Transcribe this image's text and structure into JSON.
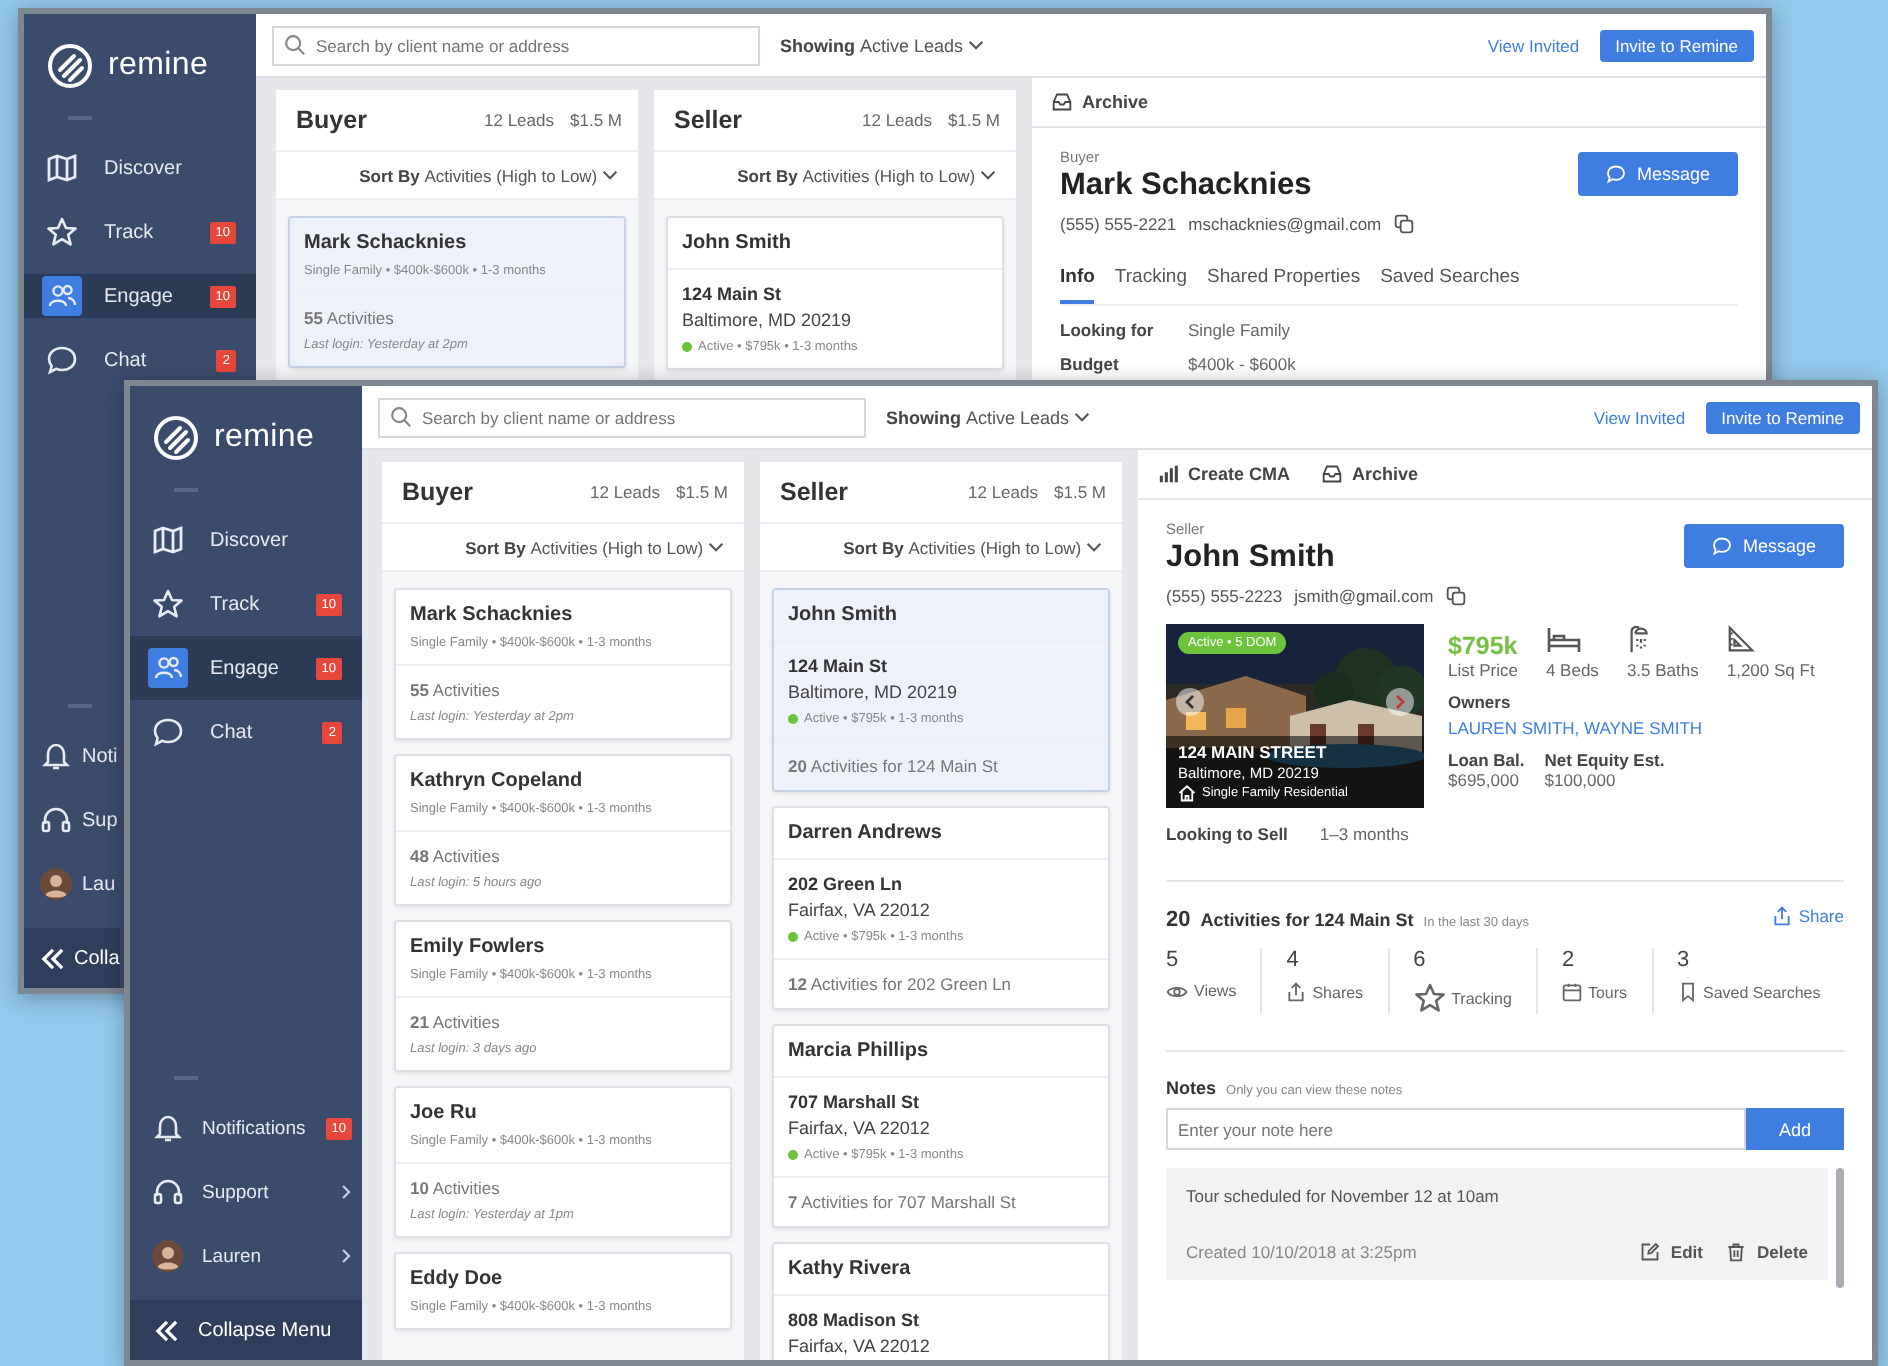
{
  "back_window": {
    "logo": "remine",
    "nav": [
      {
        "label": "Discover",
        "selected": false
      },
      {
        "label": "Track",
        "badge": "10",
        "selected": false
      },
      {
        "label": "Engage",
        "badge": "10",
        "selected": true
      },
      {
        "label": "Chat",
        "badge": "2",
        "selected": false
      }
    ],
    "bottom_nav": [
      {
        "label": "Noti"
      },
      {
        "label": "Sup"
      },
      {
        "label": "Lau"
      }
    ],
    "collapse": "Colla",
    "search": {
      "placeholder": "Search by client name or address"
    },
    "filter": {
      "prefix": "Showing",
      "value": "Active Leads"
    },
    "view_invited": "View Invited",
    "invite_button": "Invite to Remine",
    "columns": [
      {
        "title": "Buyer",
        "leads": "12 Leads",
        "total": "$1.5 M",
        "sort_label": "Sort By",
        "sort_value": "Activities (High to Low)",
        "cards": [
          {
            "kind": "buyer",
            "name": "Mark Schacknies",
            "details": "Single Family • $400k-$600k • 1-3 months",
            "activities": "**55** Activities",
            "last_login": "Last login: Yesterday at 2pm",
            "selected": true
          }
        ]
      },
      {
        "title": "Seller",
        "leads": "12 Leads",
        "total": "$1.5 M",
        "sort_label": "Sort By",
        "sort_value": "Activities (High to Low)",
        "cards": [
          {
            "kind": "seller",
            "name": "John Smith",
            "street": "124 Main St",
            "city": "Baltimore, MD 20219",
            "status": "Active • $795k • 1-3 months",
            "selected": false
          }
        ]
      }
    ],
    "detail": {
      "toolbar": [
        {
          "kind": "archive",
          "label": "Archive"
        }
      ],
      "role": "Buyer",
      "name": "Mark Schacknies",
      "message_button": "Message",
      "phone": "(555) 555-2221",
      "email": "mschacknies@gmail.com",
      "tabs": [
        {
          "label": "Info",
          "selected": true
        },
        {
          "label": "Tracking",
          "selected": false
        },
        {
          "label": "Shared Properties",
          "selected": false
        },
        {
          "label": "Saved Searches",
          "selected": false
        }
      ],
      "info": [
        {
          "label": "Looking for",
          "value": "Single Family"
        },
        {
          "label": "Budget",
          "value": "$400k - $600k"
        }
      ]
    }
  },
  "front_window": {
    "logo": "remine",
    "nav": [
      {
        "label": "Discover",
        "selected": false
      },
      {
        "label": "Track",
        "badge": "10",
        "selected": false
      },
      {
        "label": "Engage",
        "badge": "10",
        "selected": true
      },
      {
        "label": "Chat",
        "badge": "2",
        "selected": false
      }
    ],
    "bottom_nav": [
      {
        "label": "Notifications",
        "badge": "10",
        "chevron": false
      },
      {
        "label": "Support",
        "chevron": true
      },
      {
        "label": "Lauren",
        "chevron": true
      }
    ],
    "collapse": "Collapse Menu",
    "search": {
      "placeholder": "Search by client name or address"
    },
    "filter": {
      "prefix": "Showing",
      "value": "Active Leads"
    },
    "view_invited": "View Invited",
    "invite_button": "Invite to Remine",
    "columns": [
      {
        "title": "Buyer",
        "leads": "12 Leads",
        "total": "$1.5 M",
        "sort_label": "Sort By",
        "sort_value": "Activities (High to Low)",
        "cards": [
          {
            "kind": "buyer",
            "name": "Mark Schacknies",
            "details": "Single Family • $400k-$600k • 1-3 months",
            "activities": "**55** Activities",
            "last_login": "Last login: Yesterday at 2pm",
            "selected": false
          },
          {
            "kind": "buyer",
            "name": "Kathryn Copeland",
            "details": "Single Family • $400k-$600k • 1-3 months",
            "activities": "**48** Activities",
            "last_login": "Last login: 5 hours ago",
            "selected": false
          },
          {
            "kind": "buyer",
            "name": "Emily Fowlers",
            "details": "Single Family • $400k-$600k • 1-3 months",
            "activities": "**21** Activities",
            "last_login": "Last login: 3 days ago",
            "selected": false
          },
          {
            "kind": "buyer",
            "name": "Joe Ru",
            "details": "Single Family • $400k-$600k • 1-3 months",
            "activities": "**10** Activities",
            "last_login": "Last login: Yesterday at 1pm",
            "selected": false
          },
          {
            "kind": "buyer",
            "name": "Eddy Doe",
            "details": "Single Family • $400k-$600k • 1-3 months",
            "selected": false
          }
        ]
      },
      {
        "title": "Seller",
        "leads": "12 Leads",
        "total": "$1.5 M",
        "sort_label": "Sort By",
        "sort_value": "Activities (High to Low)",
        "cards": [
          {
            "kind": "seller",
            "name": "John Smith",
            "street": "124 Main St",
            "city": "Baltimore, MD 20219",
            "status": "Active • $795k • 1-3 months",
            "activities": "**20** Activities for 124 Main St",
            "selected": true
          },
          {
            "kind": "seller",
            "name": "Darren Andrews",
            "street": "202 Green Ln",
            "city": "Fairfax, VA 22012",
            "status": "Active • $795k • 1-3 months",
            "activities": "**12** Activities for 202 Green Ln",
            "selected": false
          },
          {
            "kind": "seller",
            "name": "Marcia Phillips",
            "street": "707 Marshall St",
            "city": "Fairfax, VA 22012",
            "status": "Active • $795k • 1-3 months",
            "activities": "**7** Activities for 707 Marshall St",
            "selected": false
          },
          {
            "kind": "seller",
            "name": "Kathy Rivera",
            "street": "808 Madison St",
            "city": "Fairfax, VA 22012",
            "selected": false
          }
        ]
      }
    ],
    "detail": {
      "toolbar": [
        {
          "kind": "cma",
          "label": "Create CMA"
        },
        {
          "kind": "archive",
          "label": "Archive"
        }
      ],
      "role": "Seller",
      "name": "John Smith",
      "message_button": "Message",
      "phone": "(555) 555-2223",
      "email": "jsmith@gmail.com",
      "listing": {
        "badge": "Active • 5 DOM",
        "street": "124 MAIN STREET",
        "city": "Baltimore, MD 20219",
        "type": "Single Family Residential",
        "price": "$795k",
        "price_label": "List Price",
        "features": [
          "4 Beds",
          "3.5 Baths",
          "1,200 Sq Ft"
        ],
        "owners_label": "Owners",
        "owners": "LAUREN SMITH, WAYNE SMITH",
        "loan_label": "Loan Bal.",
        "loan": "$695,000",
        "equity_label": "Net Equity Est.",
        "equity": "$100,000"
      },
      "looking": {
        "label": "Looking to Sell",
        "value": "1–3 months"
      },
      "activity": {
        "count": "20",
        "title": "Activities for 124 Main St",
        "period": "In the last 30 days",
        "share": "Share",
        "stats": [
          {
            "value": "5",
            "label": "Views"
          },
          {
            "value": "4",
            "label": "Shares"
          },
          {
            "value": "6",
            "label": "Tracking"
          },
          {
            "value": "2",
            "label": "Tours"
          },
          {
            "value": "3",
            "label": "Saved Searches"
          }
        ]
      },
      "notes": {
        "title": "Notes",
        "hint": "Only you can view these notes",
        "placeholder": "Enter your note here",
        "add_button": "Add",
        "items": [
          {
            "text": "Tour scheduled for November 12 at 10am",
            "created": "Created 10/10/2018 at 3:25pm",
            "edit": "Edit",
            "delete": "Delete"
          }
        ]
      }
    }
  }
}
